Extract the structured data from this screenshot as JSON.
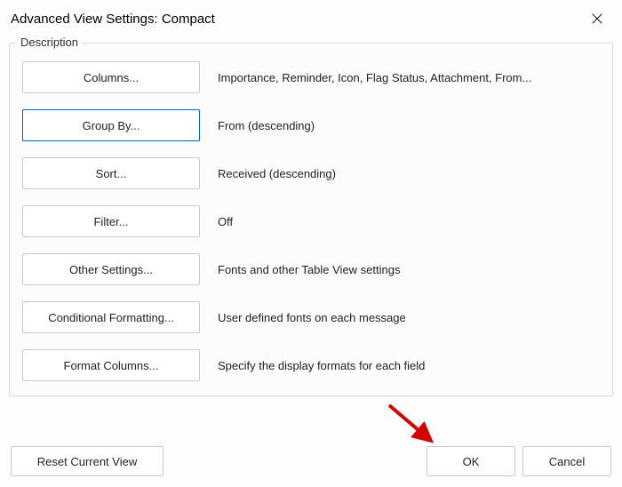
{
  "titlebar": {
    "title": "Advanced View Settings: Compact"
  },
  "fieldset": {
    "legend": "Description",
    "rows": [
      {
        "button": "Columns...",
        "desc": "Importance, Reminder, Icon, Flag Status, Attachment, From..."
      },
      {
        "button": "Group By...",
        "desc": "From (descending)"
      },
      {
        "button": "Sort...",
        "desc": "Received (descending)"
      },
      {
        "button": "Filter...",
        "desc": "Off"
      },
      {
        "button": "Other Settings...",
        "desc": "Fonts and other Table View settings"
      },
      {
        "button": "Conditional Formatting...",
        "desc": "User defined fonts on each message"
      },
      {
        "button": "Format Columns...",
        "desc": "Specify the display formats for each field"
      }
    ]
  },
  "footer": {
    "reset": "Reset Current View",
    "ok": "OK",
    "cancel": "Cancel"
  },
  "accent_color": "#d40000"
}
